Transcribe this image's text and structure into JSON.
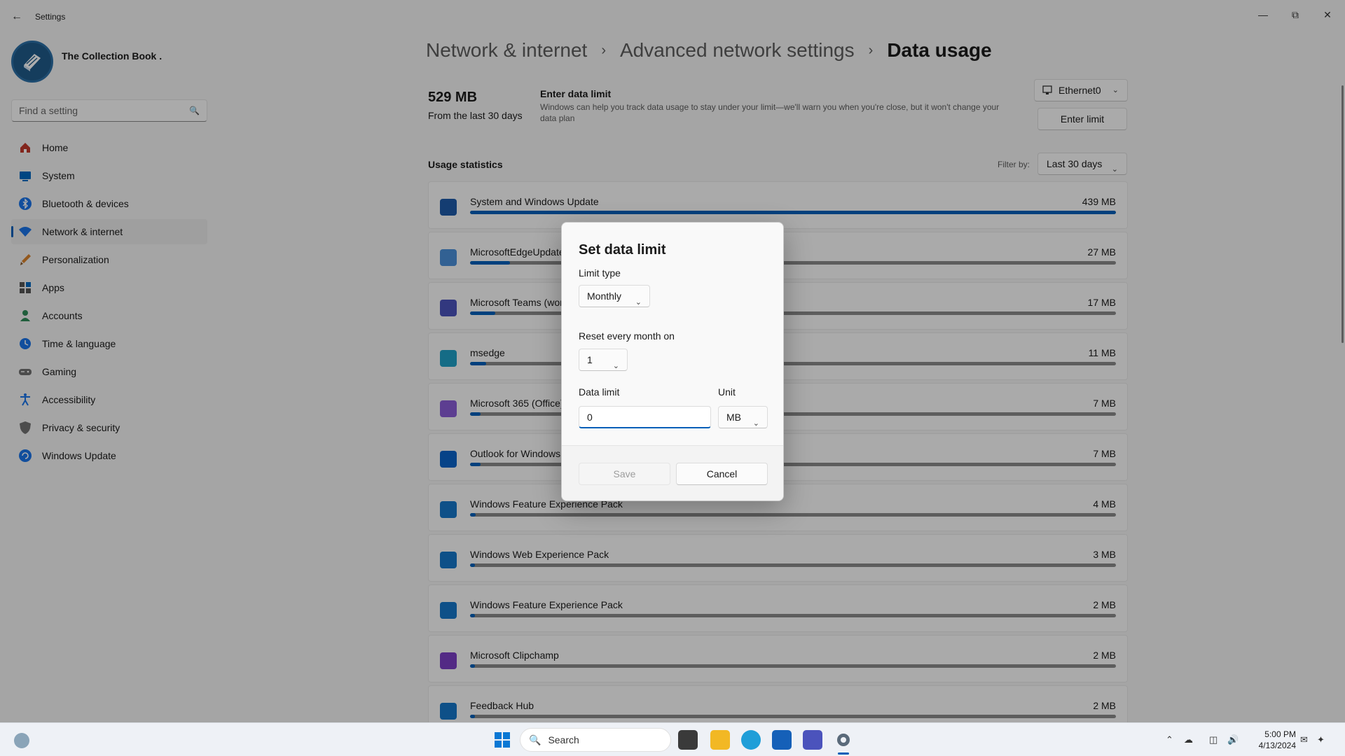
{
  "window": {
    "title": "Settings",
    "minimize_icon": "minimize-icon",
    "maximize_icon": "restore-icon",
    "close_icon": "close-icon"
  },
  "profile": {
    "name": "The Collection Book ."
  },
  "search": {
    "placeholder": "Find a setting"
  },
  "sidebar": {
    "items": [
      {
        "label": "Home",
        "icon": "home-icon",
        "color": "#c0392b"
      },
      {
        "label": "System",
        "icon": "system-icon",
        "color": "#0067c0"
      },
      {
        "label": "Bluetooth & devices",
        "icon": "bluetooth-icon",
        "color": "#1a73e8"
      },
      {
        "label": "Network & internet",
        "icon": "wifi-icon",
        "color": "#1a73e8",
        "active": true
      },
      {
        "label": "Personalization",
        "icon": "brush-icon",
        "color": "#d9822b"
      },
      {
        "label": "Apps",
        "icon": "apps-icon",
        "color": "#555555"
      },
      {
        "label": "Accounts",
        "icon": "person-icon",
        "color": "#2e8b57"
      },
      {
        "label": "Time & language",
        "icon": "globe-clock-icon",
        "color": "#1a73e8"
      },
      {
        "label": "Gaming",
        "icon": "gamepad-icon",
        "color": "#707070"
      },
      {
        "label": "Accessibility",
        "icon": "accessibility-icon",
        "color": "#1a73e8"
      },
      {
        "label": "Privacy & security",
        "icon": "shield-icon",
        "color": "#707070"
      },
      {
        "label": "Windows Update",
        "icon": "update-icon",
        "color": "#1a73e8"
      }
    ]
  },
  "breadcrumb": {
    "items": [
      "Network & internet",
      "Advanced network settings",
      "Data usage"
    ],
    "separator": "›"
  },
  "summary": {
    "total": "529 MB",
    "period": "From the last 30 days",
    "limit_title": "Enter data limit",
    "limit_description": "Windows can help you track data usage to stay under your limit—we'll warn you when you're close, but it won't change your data plan",
    "adapter": "Ethernet0",
    "enter_limit_button": "Enter limit"
  },
  "stats": {
    "title": "Usage statistics",
    "filter_label": "Filter by:",
    "filter_value": "Last 30 days",
    "apps": [
      {
        "name": "System and Windows Update",
        "size": "439 MB",
        "fraction": 1.0,
        "icon": "system-update-icon",
        "color": "#1e5aa8"
      },
      {
        "name": "MicrosoftEdgeUpdate",
        "size": "27 MB",
        "fraction": 0.062,
        "icon": "edge-update-icon",
        "color": "#4a8fd9"
      },
      {
        "name": "Microsoft Teams (work or school)",
        "size": "17 MB",
        "fraction": 0.039,
        "icon": "teams-icon",
        "color": "#4b53bc"
      },
      {
        "name": "msedge",
        "size": "11 MB",
        "fraction": 0.025,
        "icon": "edge-icon",
        "color": "#1fa0c6"
      },
      {
        "name": "Microsoft 365 (Office)",
        "size": "7 MB",
        "fraction": 0.016,
        "icon": "office-icon",
        "color": "#8a5cd6"
      },
      {
        "name": "Outlook for Windows",
        "size": "7 MB",
        "fraction": 0.016,
        "icon": "outlook-icon",
        "color": "#0a64c9"
      },
      {
        "name": "Windows Feature Experience Pack",
        "size": "4 MB",
        "fraction": 0.009,
        "icon": "feature-pack-icon",
        "color": "#1677c9"
      },
      {
        "name": "Windows Web Experience Pack",
        "size": "3 MB",
        "fraction": 0.007,
        "icon": "web-pack-icon",
        "color": "#1677c9"
      },
      {
        "name": "Windows Feature Experience Pack",
        "size": "2 MB",
        "fraction": 0.005,
        "icon": "feature-pack-icon",
        "color": "#1677c9"
      },
      {
        "name": "Microsoft Clipchamp",
        "size": "2 MB",
        "fraction": 0.005,
        "icon": "clipchamp-icon",
        "color": "#7b3fc4"
      },
      {
        "name": "Feedback Hub",
        "size": "2 MB",
        "fraction": 0.005,
        "icon": "feedback-icon",
        "color": "#1677c9"
      }
    ]
  },
  "dialog": {
    "title": "Set data limit",
    "limit_type_label": "Limit type",
    "limit_type_value": "Monthly",
    "reset_label": "Reset every month on",
    "reset_value": "1",
    "data_limit_label": "Data limit",
    "data_limit_value": "0",
    "unit_label": "Unit",
    "unit_value": "MB",
    "save_button": "Save",
    "cancel_button": "Cancel"
  },
  "taskbar": {
    "search_label": "Search",
    "time": "5:00 PM",
    "date": "4/13/2024",
    "accent": "#005fb8"
  }
}
